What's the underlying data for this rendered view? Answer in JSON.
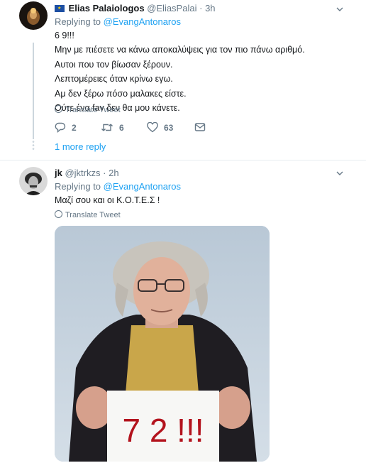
{
  "tweet1": {
    "name": "Elias Palaiologos",
    "handle": "@EliasPalai",
    "separator": "·",
    "time": "3h",
    "replying_prefix": "Replying to",
    "replying_handle": "@EvangAntonaros",
    "lines": [
      "6 9!!!",
      "Μην με πιέσετε να κάνω αποκαλύψεις για τον πιο πάνω αριθμό.",
      "Αυτοι που τον βίωσαν ξέρουν.",
      "Λεπτομέρειες όταν κρίνω εγω.",
      "Αμ δεν ξέρω πόσο μαλακες είστε.",
      "Ούτε ένα fav δεν θα μου κάνετε."
    ],
    "translate": "Translate Tweet",
    "replies": "2",
    "retweets": "6",
    "likes": "63"
  },
  "more_reply": "1 more reply",
  "tweet2": {
    "name": "jk",
    "handle": "@jktrkzs",
    "separator": "·",
    "time": "2h",
    "replying_prefix": "Replying to",
    "replying_handle": "@EvangAntonaros",
    "text": "Μαζί σου και οι Κ.Ο.Τ.Ε.Σ !",
    "translate": "Translate Tweet",
    "photo_sign": "7 2 !!!"
  },
  "colors": {
    "link": "#1da1f2",
    "muted": "#657786",
    "text": "#14171a",
    "sign_text": "#b3131d"
  }
}
